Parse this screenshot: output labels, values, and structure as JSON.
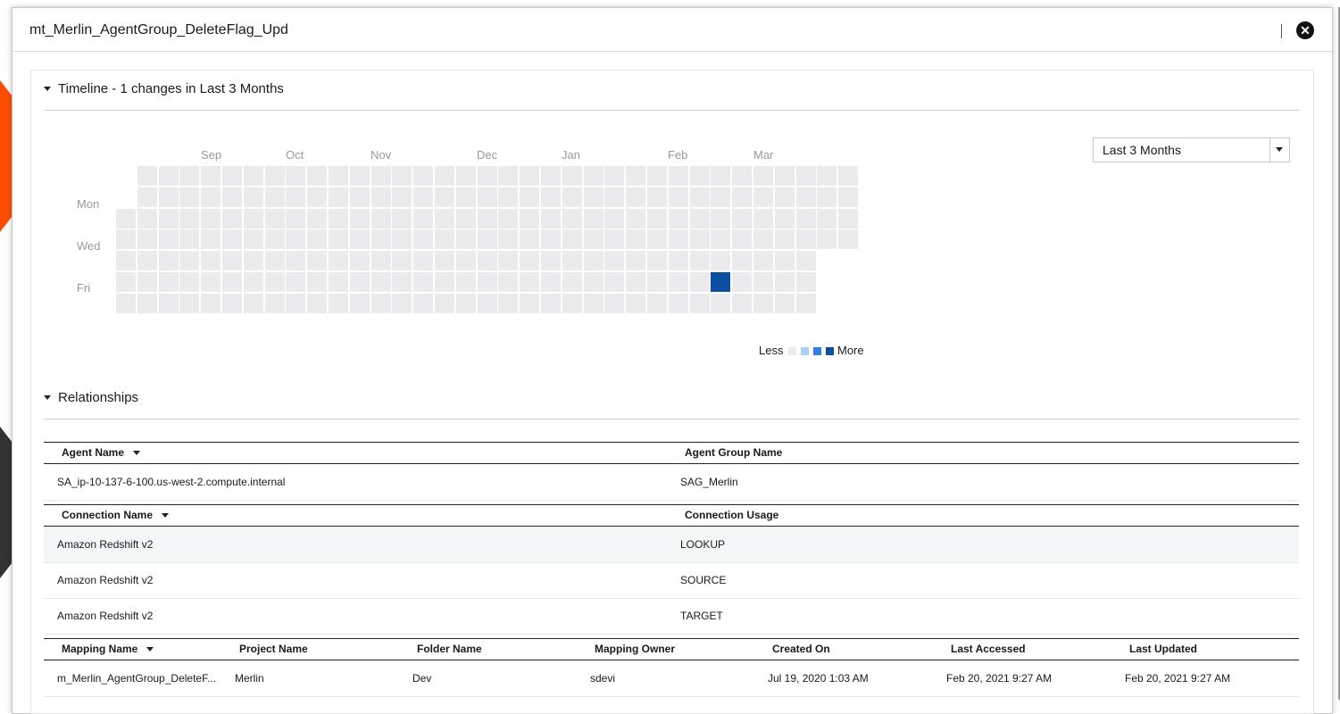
{
  "modal": {
    "title": "mt_Merlin_AgentGroup_DeleteFlag_Upd",
    "close_icon": "close-circle-icon"
  },
  "timeline": {
    "toggle_label": "Timeline - 1 changes in Last 3 Months",
    "range_select": {
      "value": "Last 3 Months"
    },
    "months": [
      "Sep",
      "Oct",
      "Nov",
      "Dec",
      "Jan",
      "Feb",
      "Mar"
    ],
    "day_labels": [
      "Mon",
      "Wed",
      "Fri"
    ],
    "legend": {
      "less": "Less",
      "more": "More",
      "colors": [
        "#ebebee",
        "#a8d1f5",
        "#2f80e0",
        "#0b4ea2"
      ]
    },
    "cell_color_empty": "#ebebee",
    "highlight": {
      "week": 28,
      "day": "Fri",
      "changes": 1,
      "color": "#0b4ea2"
    }
  },
  "relationships": {
    "toggle_label": "Relationships",
    "agents": {
      "headers": [
        "Agent Name",
        "Agent Group Name"
      ],
      "rows": [
        [
          "SA_ip-10-137-6-100.us-west-2.compute.internal",
          "SAG_Merlin"
        ]
      ]
    },
    "connections": {
      "headers": [
        "Connection Name",
        "Connection Usage"
      ],
      "rows": [
        [
          "Amazon Redshift v2",
          "LOOKUP"
        ],
        [
          "Amazon Redshift v2",
          "SOURCE"
        ],
        [
          "Amazon Redshift v2",
          "TARGET"
        ]
      ]
    },
    "mappings": {
      "headers": [
        "Mapping Name",
        "Project Name",
        "Folder Name",
        "Mapping Owner",
        "Created On",
        "Last Accessed",
        "Last Updated"
      ],
      "rows": [
        [
          "m_Merlin_AgentGroup_DeleteF...",
          "Merlin",
          "Dev",
          "sdevi",
          "Jul 19, 2020 1:03 AM",
          "Feb 20, 2021 9:27 AM",
          "Feb 20, 2021 9:27 AM"
        ]
      ]
    }
  }
}
